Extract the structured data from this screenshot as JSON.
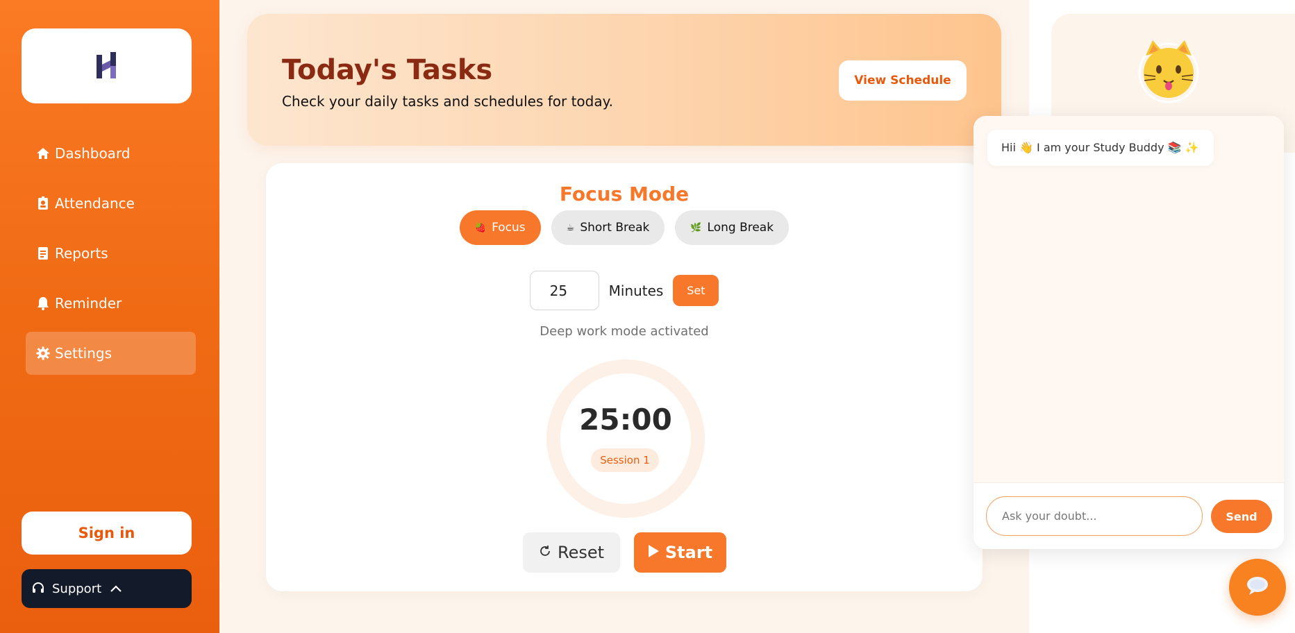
{
  "sidebar": {
    "logo_alt": "app-logo",
    "items": [
      {
        "label": "Dashboard",
        "icon": "home-icon"
      },
      {
        "label": "Attendance",
        "icon": "id-badge-icon"
      },
      {
        "label": "Reports",
        "icon": "report-icon"
      },
      {
        "label": "Reminder",
        "icon": "bell-icon"
      },
      {
        "label": "Settings",
        "icon": "gear-icon",
        "active": true
      }
    ],
    "signin_label": "Sign in",
    "support_label": "Support"
  },
  "banner": {
    "title": "Today's Tasks",
    "subtitle": "Check your daily tasks and schedules for today.",
    "button_label": "View Schedule"
  },
  "focus": {
    "title": "Focus Mode",
    "modes": [
      {
        "label": "Focus",
        "emoji": "🍓",
        "active": true
      },
      {
        "label": "Short Break",
        "emoji": "☕"
      },
      {
        "label": "Long Break",
        "emoji": "🌿"
      }
    ],
    "minutes_value": "25",
    "minutes_label": "Minutes",
    "set_label": "Set",
    "mode_description": "Deep work mode activated",
    "timer": "25:00",
    "session": "Session 1",
    "reset_label": "Reset",
    "start_label": "Start"
  },
  "chat": {
    "message": "Hii 👋 I am your Study Buddy 📚 ✨",
    "input_placeholder": "Ask your doubt...",
    "send_label": "Send"
  },
  "colors": {
    "accent": "#f7782a",
    "sidebar": "#f06a14",
    "title_dark": "#8a2a12",
    "support_bg": "#131a2a"
  }
}
